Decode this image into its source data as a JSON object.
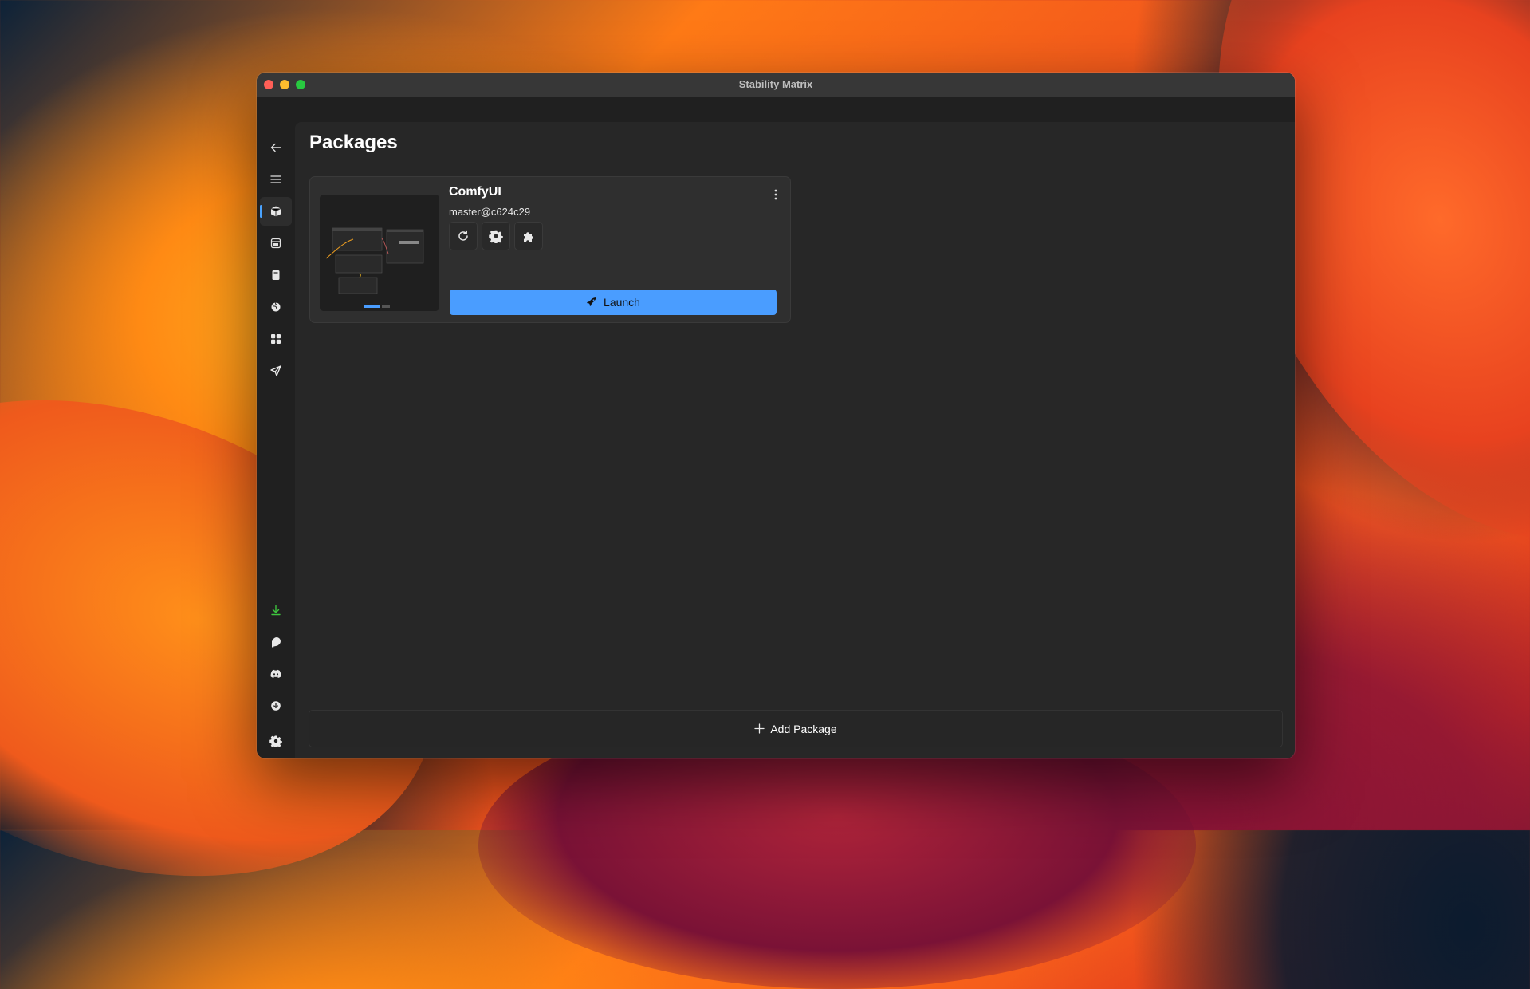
{
  "window": {
    "title": "Stability Matrix"
  },
  "page": {
    "title": "Packages"
  },
  "sidebar": {
    "top_items": [
      {
        "name": "back",
        "icon": "arrow-left-icon"
      },
      {
        "name": "menu",
        "icon": "hamburger-icon"
      },
      {
        "name": "packages",
        "icon": "package-box-icon",
        "active": true
      },
      {
        "name": "inference",
        "icon": "window-icon"
      },
      {
        "name": "checkpoints",
        "icon": "notebook-icon"
      },
      {
        "name": "model-browser",
        "icon": "globe-icon"
      },
      {
        "name": "workflows",
        "icon": "grid-icon"
      },
      {
        "name": "output-sharing",
        "icon": "send-icon"
      }
    ],
    "bottom_items": [
      {
        "name": "downloads",
        "icon": "download-icon",
        "color": "#3ec43e"
      },
      {
        "name": "patreon",
        "icon": "patreon-icon"
      },
      {
        "name": "discord",
        "icon": "discord-icon"
      },
      {
        "name": "update",
        "icon": "arrow-circle-down-icon"
      },
      {
        "name": "settings",
        "icon": "gear-icon"
      }
    ]
  },
  "packages": [
    {
      "name": "ComfyUI",
      "version": "master@c624c29",
      "actions": [
        "refresh-icon",
        "gear-icon",
        "puzzle-icon"
      ],
      "launch_label": "Launch"
    }
  ],
  "add_package_label": "Add Package",
  "colors": {
    "accent": "#4a9dff",
    "download_green": "#3ec43e"
  }
}
